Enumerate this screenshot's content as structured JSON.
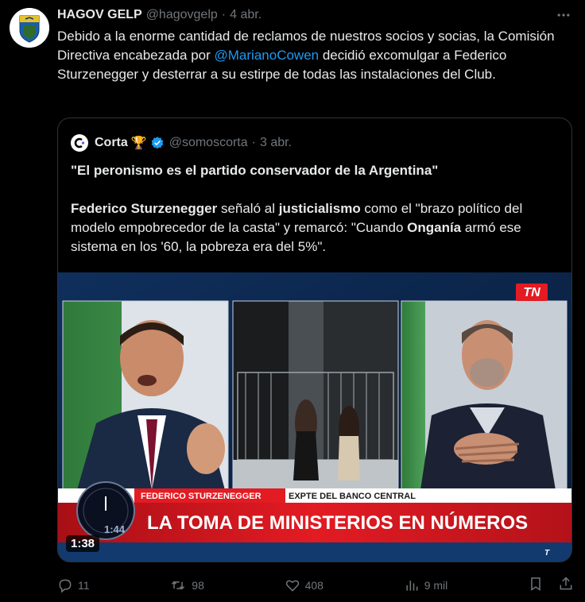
{
  "author": {
    "name": "HAGOV GELP",
    "handle": "@hagovgelp",
    "separator": "·",
    "date": "4 abr."
  },
  "tweet": {
    "text_part1": "Debido a la enorme cantidad de reclamos de nuestros socios y socias, la Comisión Directiva encabezada por ",
    "mention": "@MarianoCowen",
    "text_part2": " decidió excomulgar a Federico Sturzenegger y desterrar a su estirpe de todas las instalaciones del Club."
  },
  "quoted": {
    "name": "Corta",
    "emoji": "🏆",
    "handle": "@somoscorta",
    "separator": "·",
    "date": "3 abr.",
    "title": "\"El peronismo es el partido conservador de la Argentina\"",
    "body": {
      "b1": "Federico Sturzenegger",
      "t1": " señaló al ",
      "b2": "justicialismo",
      "t2": " como el \"brazo político del modelo empobrecedor de la casta\" y remarcó: \"Cuando ",
      "b3": "Onganía",
      "t3": " armó ese sistema en los '60, la pobreza era del 5%\"."
    },
    "video": {
      "duration": "1:38",
      "channel_logo": "TN",
      "lower_third_name": "FEDERICO STURZENEGGER",
      "lower_third_role": "EXPTE DEL BANCO CENTRAL",
      "headline": "LA TOMA DE MINISTERIOS EN NÚMEROS",
      "clock_time": "1:44"
    }
  },
  "actions": {
    "replies": "11",
    "reposts": "98",
    "likes": "408",
    "views": "9 mil"
  },
  "colors": {
    "background": "#000000",
    "text": "#e7e9ea",
    "muted": "#71767b",
    "link": "#1d9bf0",
    "border": "#2f3336",
    "tn_red": "#e31b23"
  },
  "icons": [
    "more-icon",
    "verified-icon",
    "reply-icon",
    "repost-icon",
    "like-icon",
    "views-icon",
    "bookmark-icon",
    "share-icon"
  ]
}
